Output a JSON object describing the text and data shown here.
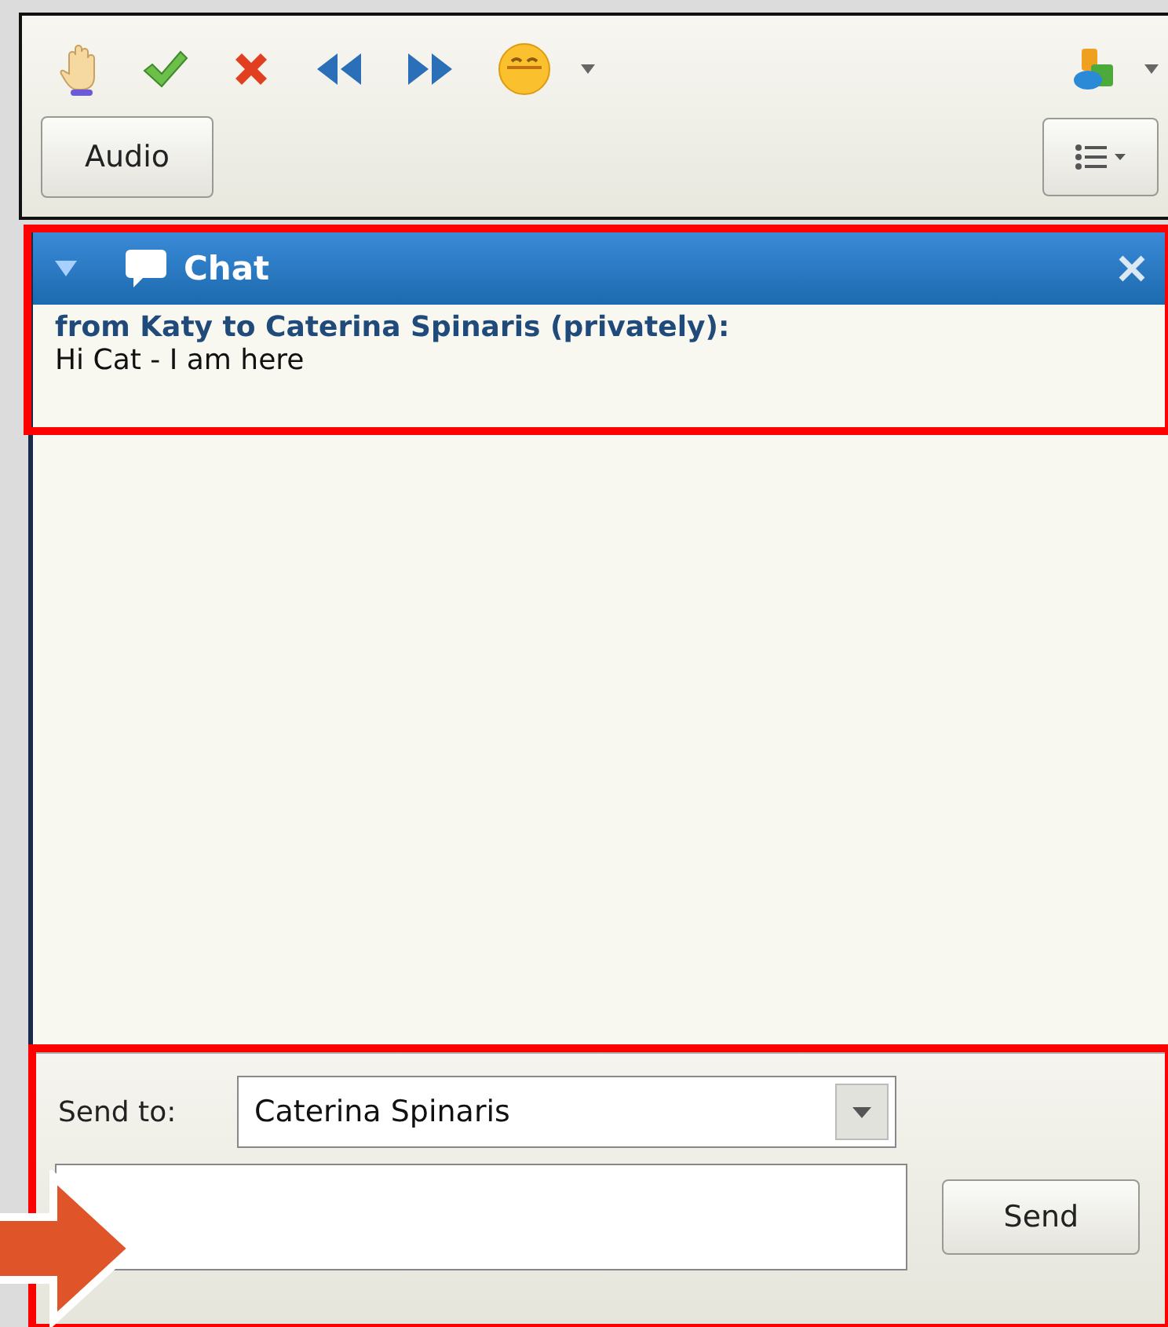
{
  "toolbar": {
    "audio_button": "Audio"
  },
  "chat": {
    "title": "Chat",
    "messages": [
      {
        "sender": "from Katy to Caterina Spinaris (privately):",
        "text": "Hi Cat - I am here"
      }
    ],
    "send_to": {
      "label": "Send to:",
      "value": "Caterina Spinaris"
    },
    "send_button": "Send"
  }
}
